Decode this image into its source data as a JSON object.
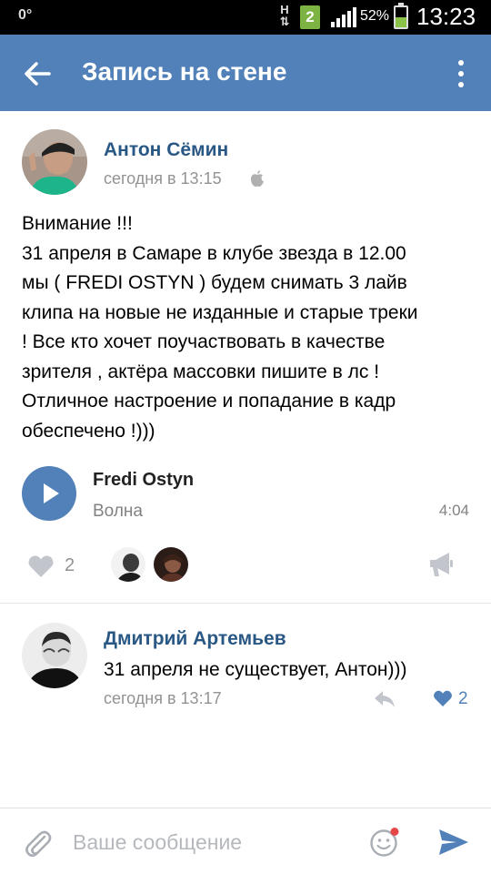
{
  "status_bar": {
    "left_indicator": "0°",
    "network_type": "H",
    "sim_slot": "2",
    "battery_percent": "52%",
    "battery_level": 0.52,
    "time": "13:23"
  },
  "app_bar": {
    "title": "Запись на стене",
    "back_icon": "arrow-left-icon",
    "menu_icon": "more-vertical-icon"
  },
  "post": {
    "author": "Антон Сёмин",
    "time": "сегодня в 13:15",
    "device_icon": "apple-icon",
    "text_lines": [
      "Внимание !!!",
      "31 апреля в Самаре в клубе звезда в 12.00",
      "мы ( FREDI OSTYN ) будем снимать 3 лайв",
      "клипа на новые не изданные и старые треки",
      "! Все кто хочет поучаствовать в качестве",
      "зрителя , актёра массовки пишите в лс !",
      "Отличное настроение  и попадание в кадр",
      "обеспечено !)))"
    ],
    "audio": {
      "artist": "Fredi Ostyn",
      "title": "Волна",
      "duration": "4:04"
    },
    "likes_count": "2"
  },
  "comment": {
    "author": "Дмитрий Артемьев",
    "text": "31 апреля не существует, Антон)))",
    "time": "сегодня в 13:17",
    "likes_count": "2"
  },
  "composer": {
    "placeholder": "Ваше сообщение"
  },
  "colors": {
    "accent": "#5181b8",
    "link": "#2a5885",
    "secondary_text": "#939393"
  }
}
